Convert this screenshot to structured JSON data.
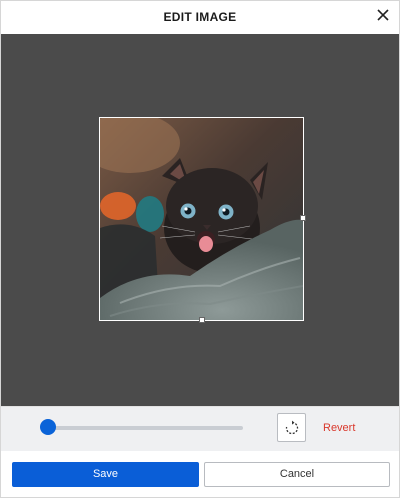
{
  "dialog": {
    "title": "EDIT IMAGE"
  },
  "image": {
    "subject": "black kitten with tongue out"
  },
  "controls": {
    "zoom_level": 0,
    "revert_label": "Revert"
  },
  "footer": {
    "save_label": "Save",
    "cancel_label": "Cancel"
  },
  "colors": {
    "primary": "#0a5ed7",
    "revert": "#d9382c",
    "canvas": "#4b4b4b"
  }
}
